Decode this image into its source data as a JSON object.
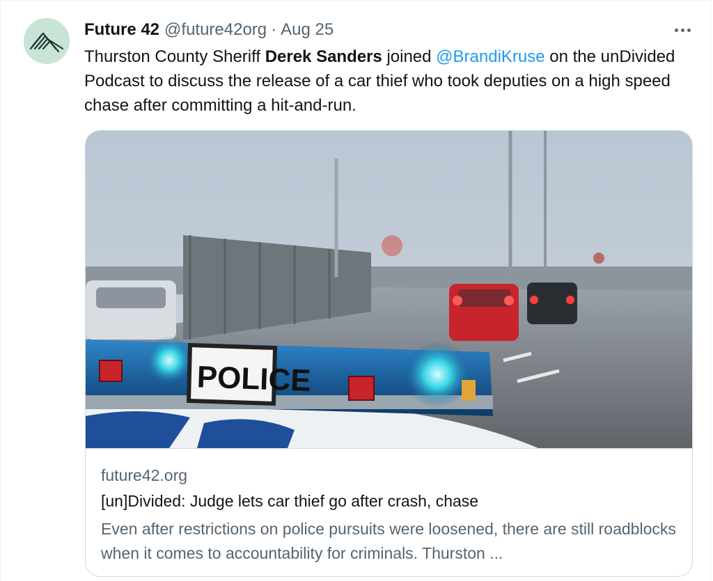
{
  "tweet": {
    "display_name": "Future 42",
    "handle": "@future42org",
    "separator": "·",
    "date": "Aug 25",
    "text_part1": "Thurston County Sheriff ",
    "text_bold": "Derek Sanders",
    "text_part2": " joined ",
    "mention": "@BrandiKruse",
    "text_part3": " on the unDivided Podcast to discuss the release of a car thief who took deputies on a high speed chase after committing a hit-and-run."
  },
  "card": {
    "police_sign": "POLICE",
    "domain": "future42.org",
    "title": "[un]Divided: Judge lets car thief go after crash, chase",
    "description": "Even after restrictions on police pursuits were loosened, there are still roadblocks when it comes to accountability for criminals. Thurston ..."
  },
  "colors": {
    "link": "#1d9bf0",
    "secondary_text": "#536471",
    "avatar_bg": "#c9e4d7"
  },
  "icons": {
    "more": "more-horizontal-icon",
    "avatar": "future42-logo"
  }
}
